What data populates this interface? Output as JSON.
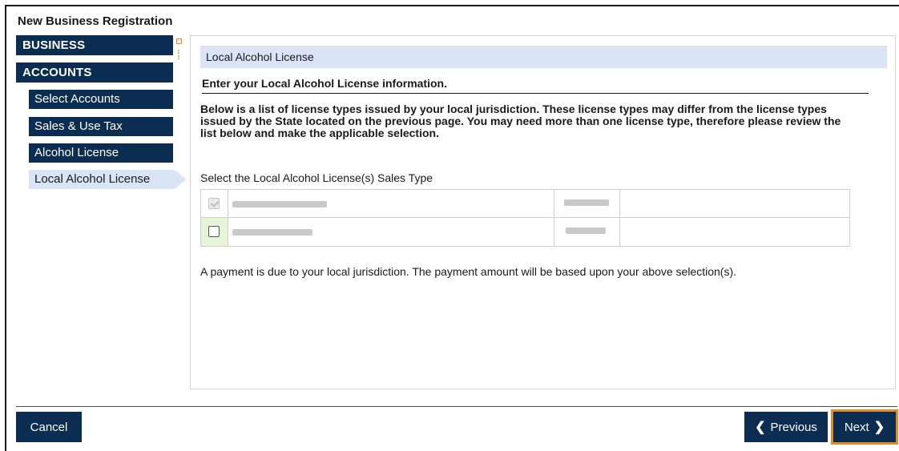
{
  "page": {
    "title": "New Business Registration"
  },
  "sidebar": {
    "sections": [
      {
        "label": "BUSINESS"
      },
      {
        "label": "ACCOUNTS"
      }
    ],
    "items": [
      {
        "label": "Select Accounts"
      },
      {
        "label": "Sales & Use Tax"
      },
      {
        "label": "Alcohol License"
      },
      {
        "label": "Local Alcohol License",
        "active": true
      }
    ]
  },
  "main": {
    "section_header": "Local Alcohol License",
    "subheading": "Enter your Local Alcohol License information.",
    "instructions": "Below is a list of license types issued by your local jurisdiction. These license types may differ from the license types issued by the State located on the previous page. You may need more than one license type, therefore please review the list below and make the applicable selection.",
    "select_label": "Select the Local Alcohol License(s) Sales Type",
    "license_rows": [
      {
        "checked": true,
        "disabled": true
      },
      {
        "checked": false,
        "disabled": false
      }
    ],
    "payment_note": "A payment is due to your local jurisdiction. The payment amount will be based upon your above selection(s)."
  },
  "footer": {
    "cancel_label": "Cancel",
    "previous_label": "Previous",
    "next_label": "Next"
  },
  "icons": {
    "collapse": "collapse-icon",
    "previous": "chevron-left-icon",
    "next": "chevron-right-icon"
  },
  "colors": {
    "nav_bg": "#0c2d52",
    "active_bg": "#d9e4f7",
    "focus_outline": "#e58a2b"
  }
}
